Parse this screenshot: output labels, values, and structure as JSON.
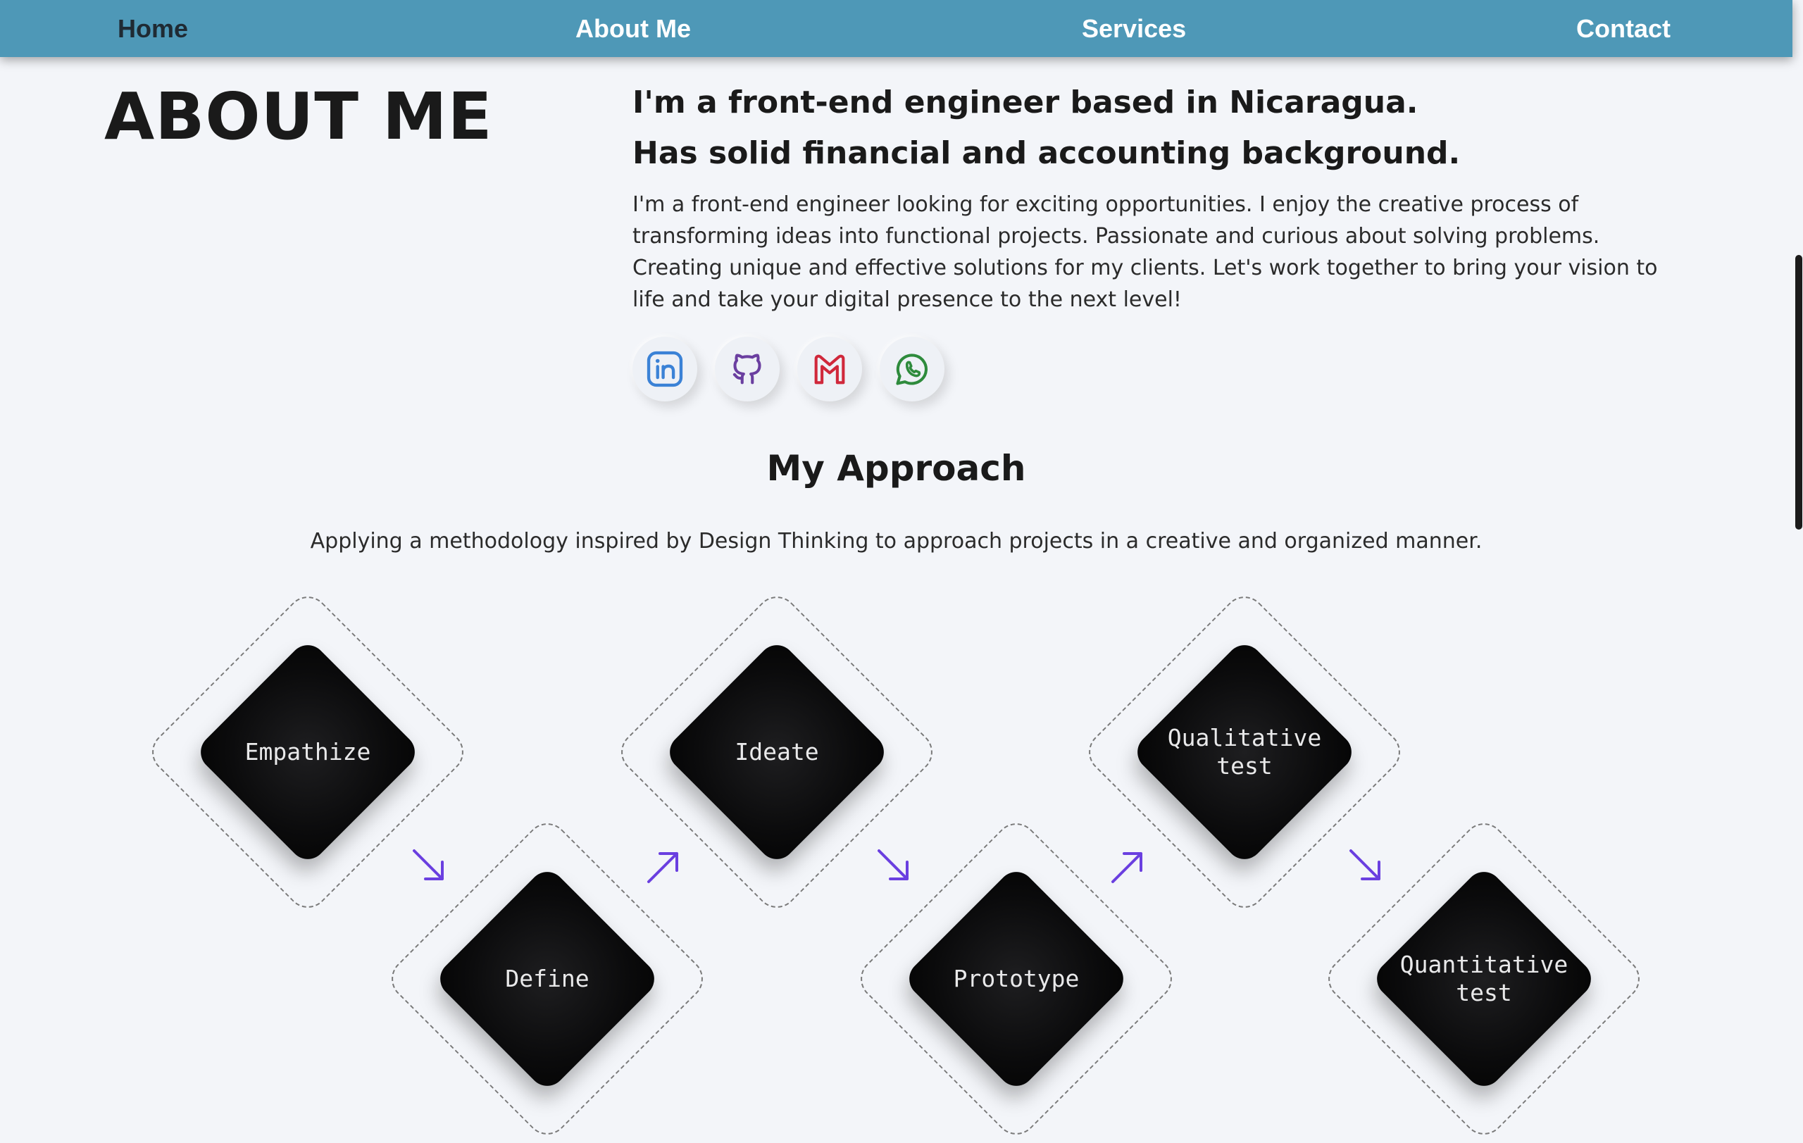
{
  "nav": {
    "home": "Home",
    "about": "About Me",
    "services": "Services",
    "contact": "Contact"
  },
  "about": {
    "heading": "ABOUT ME",
    "headline_line1": "I'm a front-end engineer based in Nicaragua.",
    "headline_line2": "Has solid financial and accounting background.",
    "bio": "I'm a front-end engineer looking for exciting opportunities. I enjoy the creative process of transforming ideas into functional projects. Passionate and curious about solving problems. Creating unique and effective solutions for my clients. Let's work together to bring your vision to life and take your digital presence to the next level!",
    "socials": [
      {
        "icon": "linkedin-icon",
        "color": "#3b82d6"
      },
      {
        "icon": "github-icon",
        "color": "#6b3fa0"
      },
      {
        "icon": "gmail-icon",
        "color": "#d0283b"
      },
      {
        "icon": "whatsapp-icon",
        "color": "#2e8b3c"
      }
    ]
  },
  "approach": {
    "title": "My Approach",
    "subtitle": "Applying a methodology inspired by Design Thinking to approach projects in a creative and organized manner.",
    "steps": [
      {
        "label": "Empathize"
      },
      {
        "label": "Define"
      },
      {
        "label": "Ideate"
      },
      {
        "label": "Prototype"
      },
      {
        "label": "Qualitative test"
      },
      {
        "label": "Quantitative test"
      }
    ],
    "arrow_color": "#6a3fe0"
  },
  "colors": {
    "nav_bg": "#4e98b7",
    "page_bg": "#f3f5f9",
    "tile_bg": "#0b0b0c"
  }
}
